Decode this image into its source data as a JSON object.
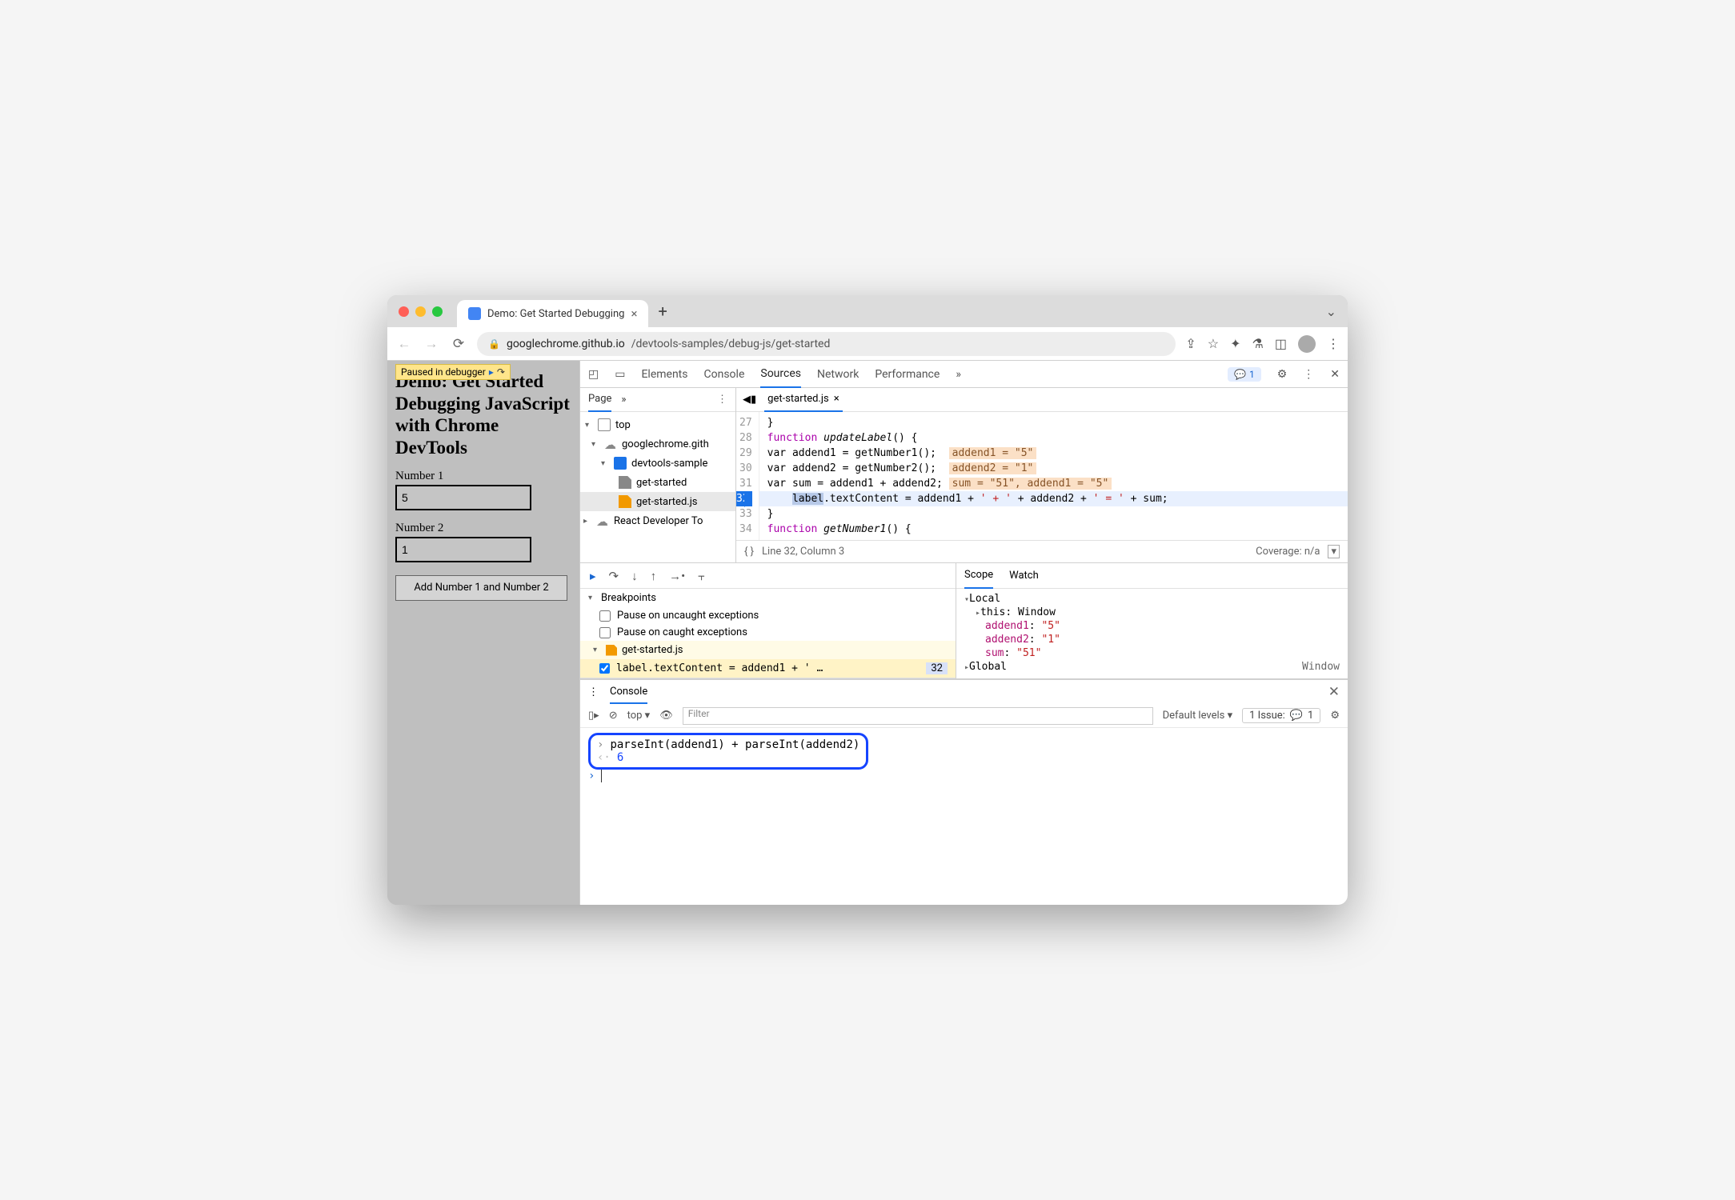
{
  "titlebar": {
    "tab_title": "Demo: Get Started Debugging"
  },
  "addrbar": {
    "url_host": "googlechrome.github.io",
    "url_path": "/devtools-samples/debug-js/get-started"
  },
  "page": {
    "paused_label": "Paused in debugger",
    "heading": "Demo: Get Started Debugging JavaScript with Chrome DevTools",
    "label1": "Number 1",
    "value1": "5",
    "label2": "Number 2",
    "value2": "1",
    "button": "Add Number 1 and Number 2"
  },
  "devtools": {
    "tabs": [
      "Elements",
      "Console",
      "Sources",
      "Network",
      "Performance"
    ],
    "active_tab": "Sources",
    "issue_count": "1",
    "nav": {
      "page": "Page",
      "tree": {
        "top": "top",
        "cloud1": "googlechrome.gith",
        "folder": "devtools-sample",
        "file_html": "get-started",
        "file_js": "get-started.js",
        "cloud2": "React Developer To"
      }
    },
    "open_file": "get-started.js",
    "code": {
      "l27": "}",
      "l28_kw": "function ",
      "l28_name": "updateLabel",
      "l28_rest": "() {",
      "l29_a": "    var addend1 = getNumber1();",
      "l29_v": "addend1 = \"5\"",
      "l30_a": "    var addend2 = getNumber2();",
      "l30_v": "addend2 = \"1\"",
      "l31_a": "    var sum = addend1 + addend2;",
      "l31_v": "sum = \"51\", addend1 = \"5\"",
      "l32_token": "label",
      "l32_rest": ".textContent = addend1 + ",
      "l32_s1": "' + '",
      "l32_mid": " + addend2 + ",
      "l32_s2": "' = '",
      "l32_end": " + sum;",
      "l33": "}",
      "l34_kw": "function ",
      "l34_name": "getNumber1",
      "l34_rest": "() {"
    },
    "lines": [
      "27",
      "28",
      "29",
      "30",
      "31",
      "32",
      "33",
      "34"
    ],
    "bp_line": "32",
    "status": {
      "braces": "{ }",
      "pos": "Line 32, Column 3",
      "coverage": "Coverage: n/a"
    },
    "breakpoints": {
      "header": "Breakpoints",
      "uncaught": "Pause on uncaught exceptions",
      "caught": "Pause on caught exceptions",
      "script": "get-started.js",
      "code": "label.textContent = addend1 + ' …",
      "code_line": "32"
    },
    "scope": {
      "tabs": [
        "Scope",
        "Watch"
      ],
      "local": "Local",
      "this_k": "this",
      "this_v": "Window",
      "a1_k": "addend1",
      "a1_v": "\"5\"",
      "a2_k": "addend2",
      "a2_v": "\"1\"",
      "sum_k": "sum",
      "sum_v": "\"51\"",
      "global": "Global",
      "global_v": "Window"
    },
    "console": {
      "tab": "Console",
      "top": "top",
      "filter_ph": "Filter",
      "levels": "Default levels",
      "issues": "1 Issue:",
      "issues_n": "1",
      "input": "parseInt(addend1) + parseInt(addend2)",
      "output": "6"
    }
  }
}
